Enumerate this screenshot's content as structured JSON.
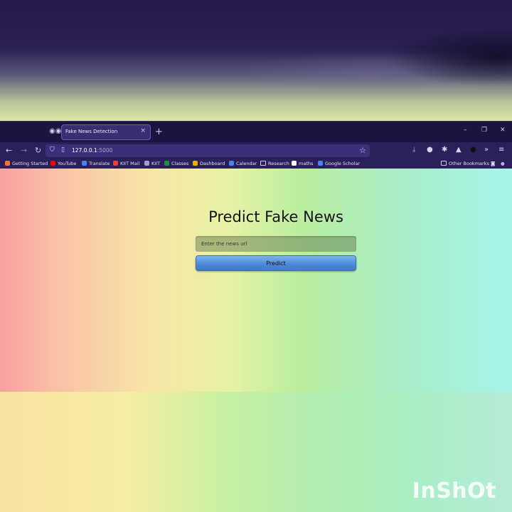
{
  "browser": {
    "tab_title": "Fake News Detection",
    "tab_close": "×",
    "new_tab": "+",
    "window_controls": {
      "minimize": "–",
      "restore": "❐",
      "close": "✕"
    },
    "nav": {
      "back": "←",
      "forward": "→",
      "reload": "↻"
    },
    "url_host": "127.0.0.1",
    "url_port": ":5000",
    "bookmarks": [
      {
        "label": "Getting Started",
        "icon": "firefox-icon",
        "color": "#ff7139"
      },
      {
        "label": "YouTube",
        "icon": "youtube-icon",
        "color": "#ff0000"
      },
      {
        "label": "Translate",
        "icon": "translate-icon",
        "color": "#4285f4"
      },
      {
        "label": "KIIT Mail",
        "icon": "gmail-icon",
        "color": "#ea4335"
      },
      {
        "label": "KIIT",
        "icon": "kiit-icon",
        "color": "#9aa0c6"
      },
      {
        "label": "Classes",
        "icon": "classroom-icon",
        "color": "#1e8e3e"
      },
      {
        "label": "Dashboard",
        "icon": "dashboard-icon",
        "color": "#f9ab00"
      },
      {
        "label": "Calendar",
        "icon": "calendar-icon",
        "color": "#4285f4"
      },
      {
        "label": "Research",
        "icon": "folder-icon",
        "color": "#cfc8ee"
      },
      {
        "label": "maths",
        "icon": "wolfram-icon",
        "color": "#ffffff"
      },
      {
        "label": "Google Scholar",
        "icon": "scholar-icon",
        "color": "#4285f4"
      }
    ],
    "other_bookmarks": "Other Bookmarks"
  },
  "page": {
    "title": "Predict Fake News",
    "input_placeholder": "Enter the news url",
    "input_value": "",
    "button_label": "Predict"
  },
  "watermark": "InShOt"
}
